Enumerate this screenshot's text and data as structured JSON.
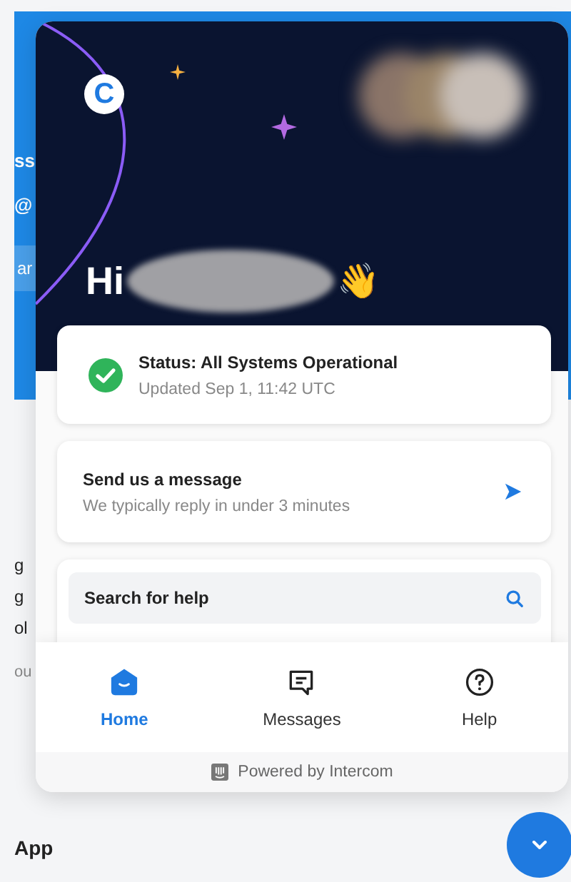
{
  "background_page": {
    "hero_fragments": [
      {
        "text": "ss",
        "kind": "heading"
      },
      {
        "text": "@",
        "kind": "heading"
      },
      {
        "text": "ar",
        "kind": "button"
      }
    ],
    "body_fragments": [
      {
        "text": "g",
        "kind": "text"
      },
      {
        "text": "g",
        "kind": "text"
      },
      {
        "text": "ol",
        "kind": "text"
      },
      {
        "text": "ou",
        "kind": "muted"
      }
    ],
    "section_title": "App"
  },
  "header": {
    "logo": "C",
    "greeting": "Hi",
    "emoji": "👋"
  },
  "status": {
    "title": "Status: All Systems Operational",
    "updated": "Updated Sep 1, 11:42 UTC"
  },
  "message_card": {
    "title": "Send us a message",
    "subtitle": "We typically reply in under 3 minutes"
  },
  "search": {
    "placeholder": "Search for help"
  },
  "nav": [
    {
      "label": "Home",
      "kind": "home",
      "selected": true
    },
    {
      "label": "Messages",
      "kind": "messages",
      "selected": false
    },
    {
      "label": "Help",
      "kind": "help",
      "selected": false
    }
  ],
  "footer": "Powered by Intercom"
}
